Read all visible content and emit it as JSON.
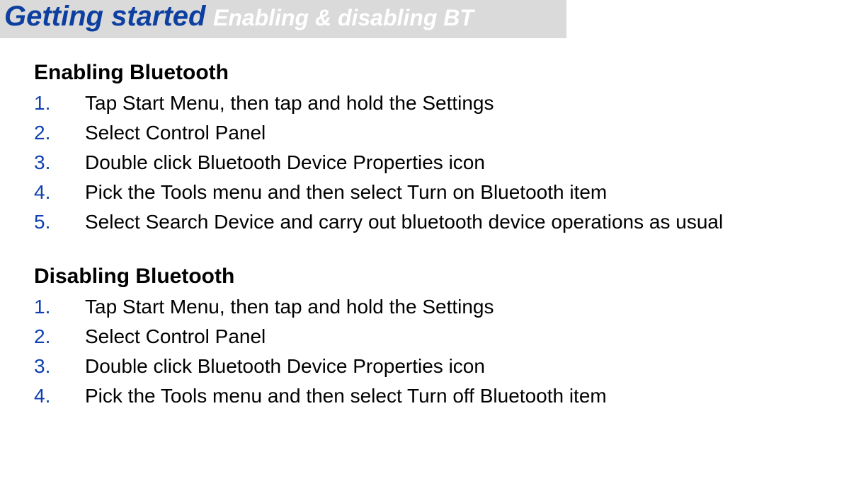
{
  "header": {
    "title_main": "Getting started",
    "title_sub": "Enabling & disabling BT"
  },
  "sections": [
    {
      "heading": "Enabling Bluetooth",
      "steps": [
        {
          "num": "1.",
          "text": "Tap Start Menu, then tap and hold the Settings"
        },
        {
          "num": "2.",
          "text": "Select Control Panel"
        },
        {
          "num": "3.",
          "text": "Double click Bluetooth Device Properties icon"
        },
        {
          "num": "4.",
          "text": "Pick the Tools menu and then select Turn on Bluetooth item"
        },
        {
          "num": "5.",
          "text": "Select Search Device and carry out bluetooth device operations as usual"
        }
      ]
    },
    {
      "heading": "Disabling Bluetooth",
      "steps": [
        {
          "num": "1.",
          "text": "Tap Start Menu, then tap and hold the Settings"
        },
        {
          "num": "2.",
          "text": "Select Control Panel"
        },
        {
          "num": "3.",
          "text": "Double click Bluetooth Device Properties icon"
        },
        {
          "num": "4.",
          "text": "Pick the Tools menu and then select Turn off Bluetooth item"
        }
      ]
    }
  ]
}
